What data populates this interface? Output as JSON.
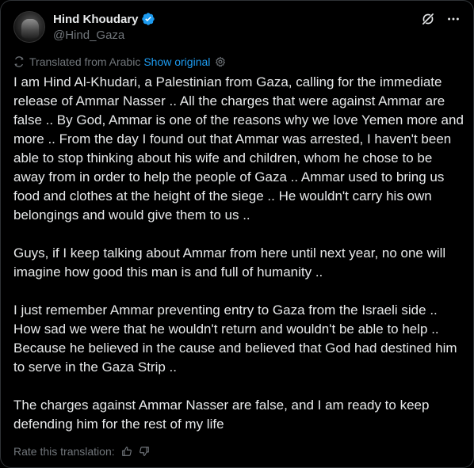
{
  "author": {
    "display_name": "Hind Khoudary",
    "handle": "@Hind_Gaza",
    "verified": true
  },
  "header_icons": {
    "grok": "grok-icon",
    "more": "more-icon"
  },
  "translation": {
    "label": "Translated from Arabic",
    "show_original": "Show original"
  },
  "tweet": {
    "paragraphs": [
      "I am Hind Al-Khudari, a Palestinian from Gaza, calling for the immediate release of Ammar Nasser .. All the charges that were against Ammar are false .. By God, Ammar is one of the reasons why we love Yemen more and more .. From the day I found out that Ammar was arrested, I haven't been able to stop thinking about his wife and children, whom he chose to be away from in order to help the people of Gaza .. Ammar used to bring us food and clothes at the height of the siege .. He wouldn't carry his own belongings and would give them to us ..",
      "Guys, if I keep talking about Ammar from here until next year, no one will imagine how good this man is and full of humanity ..",
      "I just remember Ammar preventing entry to Gaza from the Israeli side .. How sad we were that he wouldn't return and wouldn't be able to help .. Because he believed in the cause and believed that God had destined him to serve in the Gaza Strip ..",
      "The charges against Ammar Nasser are false, and I am ready to keep defending him for the rest of my life"
    ]
  },
  "rate": {
    "label": "Rate this translation:"
  },
  "colors": {
    "background": "#000000",
    "text": "#e7e9ea",
    "muted": "#71767b",
    "accent": "#1d9bf0",
    "border": "#2f3336"
  }
}
